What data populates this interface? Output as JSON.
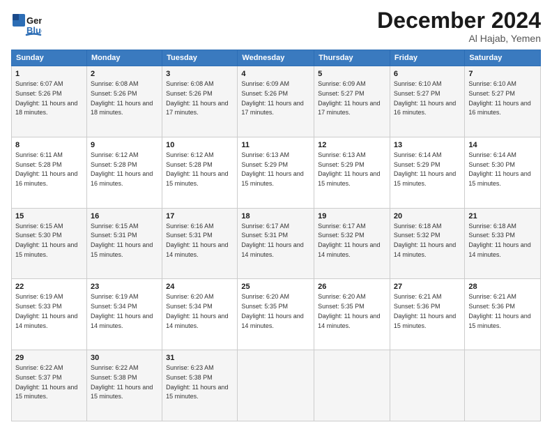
{
  "logo": {
    "line1": "General",
    "line2": "Blue"
  },
  "title": "December 2024",
  "location": "Al Hajab, Yemen",
  "days_of_week": [
    "Sunday",
    "Monday",
    "Tuesday",
    "Wednesday",
    "Thursday",
    "Friday",
    "Saturday"
  ],
  "weeks": [
    [
      {
        "day": "1",
        "sunrise": "6:07 AM",
        "sunset": "5:26 PM",
        "daylight": "11 hours and 18 minutes."
      },
      {
        "day": "2",
        "sunrise": "6:08 AM",
        "sunset": "5:26 PM",
        "daylight": "11 hours and 18 minutes."
      },
      {
        "day": "3",
        "sunrise": "6:08 AM",
        "sunset": "5:26 PM",
        "daylight": "11 hours and 17 minutes."
      },
      {
        "day": "4",
        "sunrise": "6:09 AM",
        "sunset": "5:26 PM",
        "daylight": "11 hours and 17 minutes."
      },
      {
        "day": "5",
        "sunrise": "6:09 AM",
        "sunset": "5:27 PM",
        "daylight": "11 hours and 17 minutes."
      },
      {
        "day": "6",
        "sunrise": "6:10 AM",
        "sunset": "5:27 PM",
        "daylight": "11 hours and 16 minutes."
      },
      {
        "day": "7",
        "sunrise": "6:10 AM",
        "sunset": "5:27 PM",
        "daylight": "11 hours and 16 minutes."
      }
    ],
    [
      {
        "day": "8",
        "sunrise": "6:11 AM",
        "sunset": "5:28 PM",
        "daylight": "11 hours and 16 minutes."
      },
      {
        "day": "9",
        "sunrise": "6:12 AM",
        "sunset": "5:28 PM",
        "daylight": "11 hours and 16 minutes."
      },
      {
        "day": "10",
        "sunrise": "6:12 AM",
        "sunset": "5:28 PM",
        "daylight": "11 hours and 15 minutes."
      },
      {
        "day": "11",
        "sunrise": "6:13 AM",
        "sunset": "5:29 PM",
        "daylight": "11 hours and 15 minutes."
      },
      {
        "day": "12",
        "sunrise": "6:13 AM",
        "sunset": "5:29 PM",
        "daylight": "11 hours and 15 minutes."
      },
      {
        "day": "13",
        "sunrise": "6:14 AM",
        "sunset": "5:29 PM",
        "daylight": "11 hours and 15 minutes."
      },
      {
        "day": "14",
        "sunrise": "6:14 AM",
        "sunset": "5:30 PM",
        "daylight": "11 hours and 15 minutes."
      }
    ],
    [
      {
        "day": "15",
        "sunrise": "6:15 AM",
        "sunset": "5:30 PM",
        "daylight": "11 hours and 15 minutes."
      },
      {
        "day": "16",
        "sunrise": "6:15 AM",
        "sunset": "5:31 PM",
        "daylight": "11 hours and 15 minutes."
      },
      {
        "day": "17",
        "sunrise": "6:16 AM",
        "sunset": "5:31 PM",
        "daylight": "11 hours and 14 minutes."
      },
      {
        "day": "18",
        "sunrise": "6:17 AM",
        "sunset": "5:31 PM",
        "daylight": "11 hours and 14 minutes."
      },
      {
        "day": "19",
        "sunrise": "6:17 AM",
        "sunset": "5:32 PM",
        "daylight": "11 hours and 14 minutes."
      },
      {
        "day": "20",
        "sunrise": "6:18 AM",
        "sunset": "5:32 PM",
        "daylight": "11 hours and 14 minutes."
      },
      {
        "day": "21",
        "sunrise": "6:18 AM",
        "sunset": "5:33 PM",
        "daylight": "11 hours and 14 minutes."
      }
    ],
    [
      {
        "day": "22",
        "sunrise": "6:19 AM",
        "sunset": "5:33 PM",
        "daylight": "11 hours and 14 minutes."
      },
      {
        "day": "23",
        "sunrise": "6:19 AM",
        "sunset": "5:34 PM",
        "daylight": "11 hours and 14 minutes."
      },
      {
        "day": "24",
        "sunrise": "6:20 AM",
        "sunset": "5:34 PM",
        "daylight": "11 hours and 14 minutes."
      },
      {
        "day": "25",
        "sunrise": "6:20 AM",
        "sunset": "5:35 PM",
        "daylight": "11 hours and 14 minutes."
      },
      {
        "day": "26",
        "sunrise": "6:20 AM",
        "sunset": "5:35 PM",
        "daylight": "11 hours and 14 minutes."
      },
      {
        "day": "27",
        "sunrise": "6:21 AM",
        "sunset": "5:36 PM",
        "daylight": "11 hours and 15 minutes."
      },
      {
        "day": "28",
        "sunrise": "6:21 AM",
        "sunset": "5:36 PM",
        "daylight": "11 hours and 15 minutes."
      }
    ],
    [
      {
        "day": "29",
        "sunrise": "6:22 AM",
        "sunset": "5:37 PM",
        "daylight": "11 hours and 15 minutes."
      },
      {
        "day": "30",
        "sunrise": "6:22 AM",
        "sunset": "5:38 PM",
        "daylight": "11 hours and 15 minutes."
      },
      {
        "day": "31",
        "sunrise": "6:23 AM",
        "sunset": "5:38 PM",
        "daylight": "11 hours and 15 minutes."
      },
      null,
      null,
      null,
      null
    ]
  ]
}
